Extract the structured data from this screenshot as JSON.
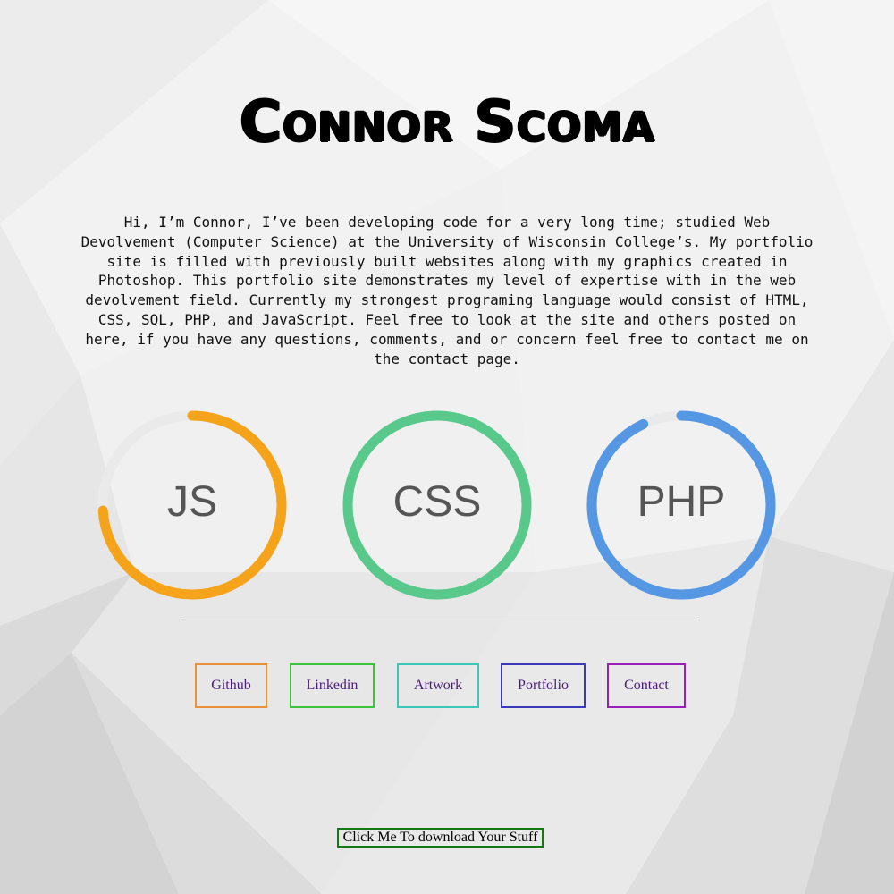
{
  "header": {
    "name": "Connor Scoma"
  },
  "bio": {
    "text": "Hi, I’m Connor, I’ve been developing code for a very long time; studied Web Devolvement (Computer Science) at the University of Wisconsin College’s. My portfolio site is filled with previously built websites along with my graphics created in Photoshop. This portfolio site demonstrates my level of expertise with in the web devolvement field. Currently my strongest programing language would consist of HTML, CSS, SQL, PHP, and JavaScript. Feel free to look at the site and others posted on here, if you have any questions, comments, and or concern feel free to contact me on the contact page."
  },
  "skills": [
    {
      "label": "JS",
      "color": "#f5a31a",
      "progress": 0.74
    },
    {
      "label": "CSS",
      "color": "#59c98b",
      "progress": 1.0
    },
    {
      "label": "PHP",
      "color": "#5597e3",
      "progress": 0.93
    }
  ],
  "links": [
    {
      "label": "Github",
      "border": "#e8913a"
    },
    {
      "label": "Linkedin",
      "border": "#3cc23c"
    },
    {
      "label": "Artwork",
      "border": "#3cc7b8"
    },
    {
      "label": "Portfolio",
      "border": "#3a3ab8"
    },
    {
      "label": "Contact",
      "border": "#9a1fb8"
    }
  ],
  "download": {
    "label": "Click Me To download Your Stuff"
  }
}
